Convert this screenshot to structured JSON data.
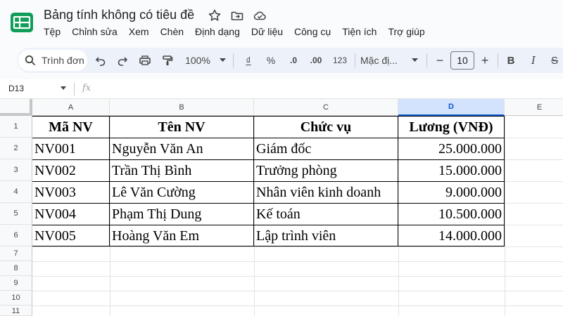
{
  "app": {
    "title": "Bảng tính không có tiêu đề",
    "brand_color": "#0f9d58"
  },
  "menu": [
    "Tệp",
    "Chỉnh sửa",
    "Xem",
    "Chèn",
    "Định dạng",
    "Dữ liệu",
    "Công cụ",
    "Tiện ích",
    "Trợ giúp"
  ],
  "toolbar": {
    "search_placeholder": "Trình đơn",
    "zoom": "100%",
    "currency_symbol": "₫",
    "percent_symbol": "%",
    "decrease_decimal": ".0",
    "increase_decimal": ".00",
    "format_123": "123",
    "font_name": "Mặc đị...",
    "font_size": "10",
    "minus": "−",
    "plus": "+",
    "bold": "B",
    "italic": "I",
    "strike": "S"
  },
  "formula_bar": {
    "name_box": "D13",
    "fx_label": "fx"
  },
  "sheet": {
    "selected_column": "D",
    "column_headers": [
      "A",
      "B",
      "C",
      "D",
      "E"
    ],
    "row_numbers": [
      "1",
      "2",
      "3",
      "4",
      "5",
      "6",
      "7",
      "8",
      "9",
      "10",
      "11"
    ],
    "table_header": [
      "Mã NV",
      "Tên NV",
      "Chức vụ",
      "Lương (VNĐ)"
    ],
    "rows": [
      [
        "NV001",
        "Nguyễn Văn An",
        "Giám đốc",
        "25.000.000"
      ],
      [
        "NV002",
        "Trần Thị Bình",
        "Trưởng phòng",
        "15.000.000"
      ],
      [
        "NV003",
        "Lê Văn Cường",
        "Nhân viên kinh doanh",
        "9.000.000"
      ],
      [
        "NV004",
        "Phạm Thị Dung",
        "Kế toán",
        "10.500.000"
      ],
      [
        "NV005",
        "Hoàng Văn Em",
        "Lập trình viên",
        "14.000.000"
      ]
    ]
  }
}
